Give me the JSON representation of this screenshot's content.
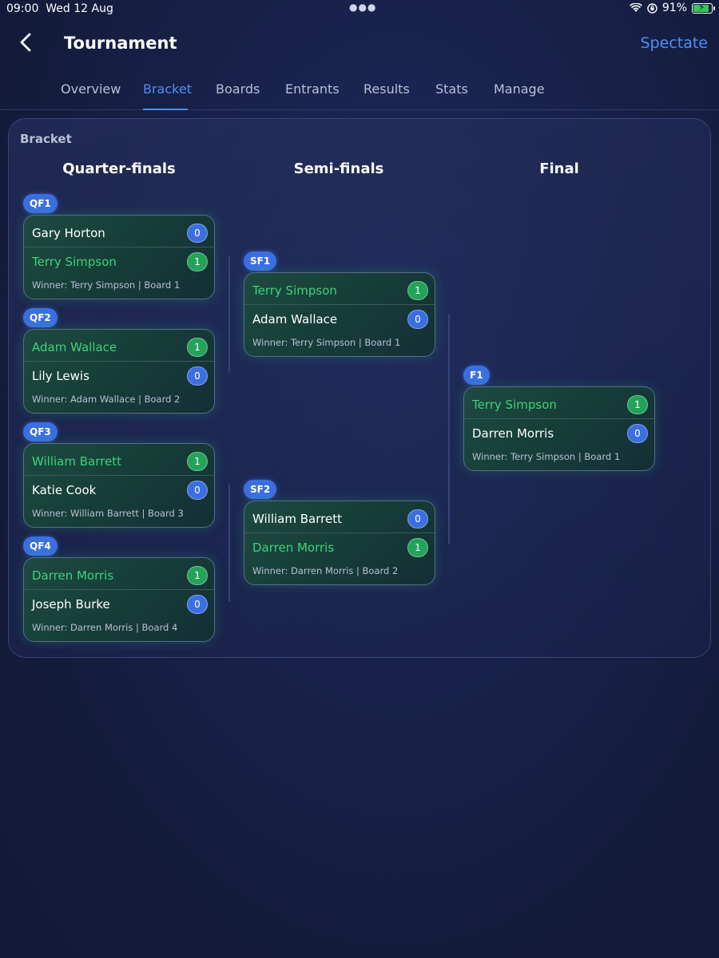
{
  "status": {
    "time": "09:00",
    "date": "Wed 12 Aug",
    "battery": "91%",
    "battery_level": 0.91
  },
  "nav": {
    "title": "Tournament",
    "action": "Spectate"
  },
  "tabs": [
    "Overview",
    "Bracket",
    "Boards",
    "Entrants",
    "Results",
    "Stats",
    "Manage"
  ],
  "active_tab": "Bracket",
  "bracket": {
    "label": "Bracket",
    "rounds": [
      "Quarter-finals",
      "Semi-finals",
      "Final"
    ],
    "matches": {
      "qf1": {
        "id": "QF1",
        "p1": "Gary Horton",
        "s1": "0",
        "p2": "Terry Simpson",
        "s2": "1",
        "footer": "Winner: Terry Simpson | Board 1"
      },
      "qf2": {
        "id": "QF2",
        "p1": "Adam Wallace",
        "s1": "1",
        "p2": "Lily Lewis",
        "s2": "0",
        "footer": "Winner: Adam Wallace | Board 2"
      },
      "qf3": {
        "id": "QF3",
        "p1": "William Barrett",
        "s1": "1",
        "p2": "Katie Cook",
        "s2": "0",
        "footer": "Winner: William Barrett | Board 3"
      },
      "qf4": {
        "id": "QF4",
        "p1": "Darren Morris",
        "s1": "1",
        "p2": "Joseph Burke",
        "s2": "0",
        "footer": "Winner: Darren Morris | Board 4"
      },
      "sf1": {
        "id": "SF1",
        "p1": "Terry Simpson",
        "s1": "1",
        "p2": "Adam Wallace",
        "s2": "0",
        "footer": "Winner: Terry Simpson | Board 1"
      },
      "sf2": {
        "id": "SF2",
        "p1": "William Barrett",
        "s1": "0",
        "p2": "Darren Morris",
        "s2": "1",
        "footer": "Winner: Darren Morris | Board 2"
      },
      "f1": {
        "id": "F1",
        "p1": "Terry Simpson",
        "s1": "1",
        "p2": "Darren Morris",
        "s2": "0",
        "footer": "Winner: Terry Simpson | Board 1"
      }
    }
  },
  "colors": {
    "accent": "#4f8ff7",
    "winner": "#3ed27a",
    "win_score": "#23a35a",
    "lose_score": "#3b6fe0"
  },
  "icons": {
    "back": "chevron-left-icon",
    "wifi": "wifi-icon",
    "orientation_lock": "orientation-lock-icon",
    "battery": "battery-charging-icon"
  }
}
